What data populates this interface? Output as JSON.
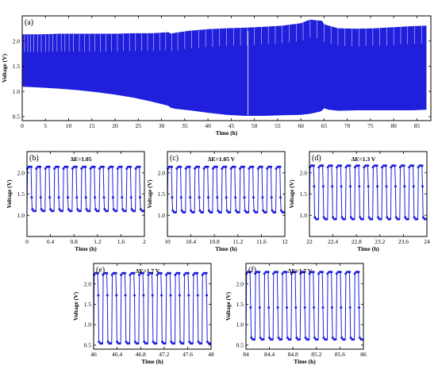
{
  "colors": {
    "series": "#1f1fdc",
    "axis": "#000000",
    "background": "#ffffff"
  },
  "chart_data": [
    {
      "id": "a",
      "type": "line",
      "panel_label": "(a)",
      "xlabel": "Time (h)",
      "ylabel": "Voltage (V)",
      "xlim": [
        0,
        88
      ],
      "ylim": [
        0.42,
        2.5
      ],
      "xticks": [
        0,
        5,
        10,
        15,
        20,
        25,
        30,
        35,
        40,
        45,
        50,
        55,
        60,
        65,
        70,
        75,
        80,
        85
      ],
      "yticks": [
        0.5,
        1.0,
        1.5,
        2.0
      ],
      "ytick_labels": [
        "0.5",
        "1.0",
        "1.5",
        "2.0"
      ],
      "annotation": "",
      "series": [
        {
          "x": [
            0,
            4,
            8,
            12,
            16,
            20,
            24,
            28,
            31.5,
            32,
            33,
            36,
            40,
            44,
            48,
            52,
            56,
            60,
            62,
            63,
            64,
            64.5,
            65,
            66,
            68,
            72,
            76,
            80,
            84,
            87
          ],
          "upper": [
            2.13,
            2.13,
            2.14,
            2.14,
            2.14,
            2.14,
            2.15,
            2.15,
            2.17,
            2.14,
            2.16,
            2.2,
            2.23,
            2.25,
            2.26,
            2.28,
            2.3,
            2.35,
            2.42,
            2.41,
            2.4,
            2.4,
            2.33,
            2.3,
            2.25,
            2.24,
            2.25,
            2.27,
            2.29,
            2.3
          ],
          "lower": [
            1.1,
            1.08,
            1.06,
            1.03,
            0.99,
            0.94,
            0.88,
            0.8,
            0.72,
            0.68,
            0.66,
            0.63,
            0.58,
            0.54,
            0.52,
            0.52,
            0.53,
            0.54,
            0.56,
            0.58,
            0.6,
            0.62,
            0.67,
            0.64,
            0.62,
            0.63,
            0.63,
            0.63,
            0.63,
            0.64
          ]
        }
      ],
      "spikes": [
        0.5,
        1.2,
        1.8,
        2.5,
        3.3,
        4.1,
        5,
        5.8,
        6.6,
        7.5,
        8.4,
        9.2,
        10.1,
        11,
        12.3,
        13.4,
        14.5,
        15.6,
        16.8,
        18,
        19.2,
        20.5,
        21.8,
        23.1,
        24.4,
        25.7,
        27,
        28.3,
        29.6,
        30.9,
        32.2,
        33.5,
        35,
        36.5,
        38,
        39.5,
        41,
        42.5,
        44,
        45.5,
        47,
        48.5,
        50,
        51.5,
        53,
        54.5,
        56,
        57.5,
        59,
        60.5,
        62,
        63.5,
        65,
        66.5,
        68,
        69.5,
        71,
        72.5,
        74,
        75.5,
        77,
        78.5,
        80,
        81.5,
        83,
        84.5,
        86
      ]
    },
    {
      "id": "b",
      "type": "line",
      "panel_label": "(b)",
      "xlabel": "Time (h)",
      "ylabel": "Voltage (V)",
      "xlim": [
        0,
        2.0
      ],
      "ylim": [
        0.5,
        2.5
      ],
      "xticks": [
        0.0,
        0.4,
        0.8,
        1.2,
        1.6,
        2.0
      ],
      "yticks": [
        1.0,
        1.5,
        2.0
      ],
      "ytick_labels": [
        "1.0",
        "1.5",
        "2.0"
      ],
      "annotation": "ΔE=1.05",
      "cycles": 13,
      "high": 2.14,
      "low": 1.1,
      "mid": 1.42
    },
    {
      "id": "c",
      "type": "line",
      "panel_label": "(c)",
      "xlabel": "Time (h)",
      "ylabel": "Voltage (V)",
      "xlim": [
        10.0,
        12.0
      ],
      "ylim": [
        0.5,
        2.5
      ],
      "xticks": [
        10.0,
        10.4,
        10.8,
        11.2,
        11.6,
        12.0
      ],
      "yticks": [
        1.0,
        1.5,
        2.0
      ],
      "ytick_labels": [
        "1.0",
        "1.5",
        "2.0"
      ],
      "annotation": "ΔE=1.05 V",
      "cycles": 13,
      "high": 2.14,
      "low": 1.07,
      "mid": 1.42
    },
    {
      "id": "d",
      "type": "line",
      "panel_label": "(d)",
      "xlabel": "Time (h)",
      "ylabel": "Voltage (V)",
      "xlim": [
        22.0,
        24.0
      ],
      "ylim": [
        0.5,
        2.5
      ],
      "xticks": [
        22.0,
        22.4,
        22.8,
        23.2,
        23.6,
        24.0
      ],
      "yticks": [
        1.0,
        1.5,
        2.0
      ],
      "ytick_labels": [
        "1.0",
        "1.5",
        "2.0"
      ],
      "annotation": "ΔE=1.3 V",
      "cycles": 13,
      "high": 2.17,
      "low": 0.91,
      "mid": 1.68
    },
    {
      "id": "e",
      "type": "line",
      "panel_label": "(e)",
      "xlabel": "Time (h)",
      "ylabel": "Voltage (V)",
      "xlim": [
        46.0,
        48.0
      ],
      "ylim": [
        0.4,
        2.5
      ],
      "xticks": [
        46.0,
        46.4,
        46.8,
        47.2,
        47.6,
        48.0
      ],
      "yticks": [
        0.5,
        1.0,
        1.5,
        2.0
      ],
      "ytick_labels": [
        "0.5",
        "1.0",
        "1.5",
        "2.0"
      ],
      "annotation": "ΔE=1.7 V",
      "cycles": 13,
      "high": 2.26,
      "low": 0.54,
      "mid": 1.72
    },
    {
      "id": "f",
      "type": "line",
      "panel_label": "(f)",
      "xlabel": "Time (h)",
      "ylabel": "Voltage (V)",
      "xlim": [
        84.0,
        86.0
      ],
      "ylim": [
        0.4,
        2.5
      ],
      "xticks": [
        84.0,
        84.4,
        84.8,
        85.2,
        85.6,
        86.0
      ],
      "yticks": [
        0.5,
        1.0,
        1.5,
        2.0
      ],
      "ytick_labels": [
        "0.5",
        "1.0",
        "1.5",
        "2.0"
      ],
      "annotation": "ΔE=1.7 V",
      "cycles": 13,
      "high": 2.29,
      "low": 0.64,
      "mid": 1.42
    }
  ]
}
